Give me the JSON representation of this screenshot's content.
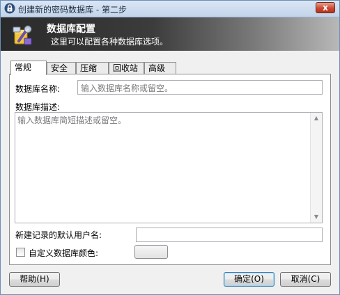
{
  "window": {
    "title": "创建新的密码数据库 - 第二步",
    "close_label": "x"
  },
  "banner": {
    "title": "数据库配置",
    "subtitle": "这里可以配置各种数据库选项。"
  },
  "tabs": [
    "常规",
    "安全",
    "压缩",
    "回收站",
    "高级"
  ],
  "general": {
    "name_label": "数据库名称:",
    "name_placeholder": "输入数据库名称或留空。",
    "desc_label": "数据库描述:",
    "desc_placeholder": "输入数据库简短描述或留空。",
    "default_user_label": "新建记录的默认用户名:",
    "default_user_value": "",
    "custom_color_label": "自定义数据库颜色:",
    "custom_color_checked": false
  },
  "buttons": {
    "help": "帮助(H)",
    "ok": "确定(O)",
    "cancel": "取消(C)"
  },
  "icons": {
    "title": "lock-icon",
    "banner": "database-settings-icon",
    "scroll_up": "scroll-up-arrow-icon",
    "scroll_down": "scroll-down-arrow-icon"
  },
  "colors": {
    "banner_dark": "#2a2a2a",
    "close_red": "#c94a34",
    "default_button_border": "#3c7fb1"
  }
}
